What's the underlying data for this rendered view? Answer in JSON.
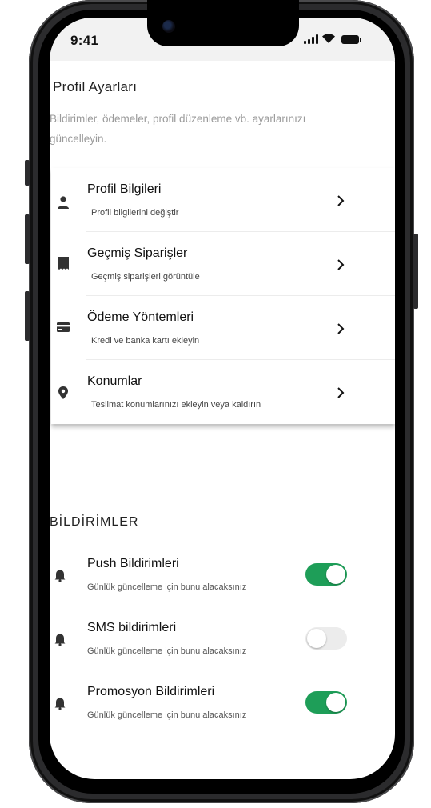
{
  "status_bar": {
    "time": "9:41"
  },
  "profile": {
    "title": "Profil Ayarları",
    "subtitle": "Bildirimler, ödemeler, profil düzenleme vb. ayarlarınızı güncelleyin."
  },
  "menu": [
    {
      "title": "Profil Bilgileri",
      "desc": "Profil bilgilerini değiştir",
      "icon": "person-icon"
    },
    {
      "title": "Geçmiş Siparişler",
      "desc": "Geçmiş siparişleri görüntüle",
      "icon": "receipt-icon"
    },
    {
      "title": "Ödeme Yöntemleri",
      "desc": "Kredi ve banka kartı ekleyin",
      "icon": "credit-card-icon"
    },
    {
      "title": "Konumlar",
      "desc": "Teslimat konumlarınızı ekleyin veya kaldırın",
      "icon": "location-pin-icon"
    }
  ],
  "notifications": {
    "section_title": "BİLDİRİMLER",
    "items": [
      {
        "title": "Push Bildirimleri",
        "desc": "Günlük güncelleme için bunu alacaksınız",
        "enabled": true
      },
      {
        "title": "SMS bildirimleri",
        "desc": "Günlük güncelleme için bunu alacaksınız",
        "enabled": false
      },
      {
        "title": "Promosyon Bildirimleri",
        "desc": "Günlük güncelleme için bunu alacaksınız",
        "enabled": true
      }
    ]
  },
  "colors": {
    "toggle_on": "#1e9e58",
    "toggle_off": "#ececec",
    "subtitle_text": "#9a9a9a"
  }
}
